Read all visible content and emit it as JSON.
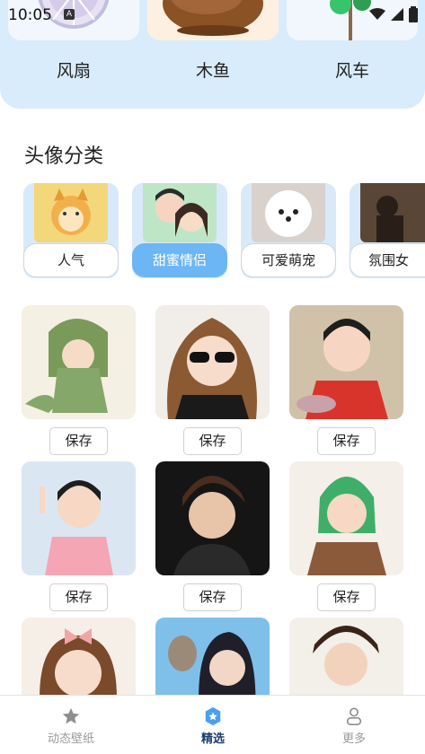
{
  "status_bar": {
    "time": "10:05",
    "badge": "A"
  },
  "tools": [
    {
      "label": "风扇"
    },
    {
      "label": "木鱼"
    },
    {
      "label": "风车"
    }
  ],
  "section_title": "头像分类",
  "categories": [
    {
      "label": "人气",
      "active": false
    },
    {
      "label": "甜蜜情侣",
      "active": true
    },
    {
      "label": "可爱萌宠",
      "active": false
    },
    {
      "label": "氛围女",
      "active": false
    }
  ],
  "grid": [
    {
      "save_label": "保存"
    },
    {
      "save_label": "保存"
    },
    {
      "save_label": "保存"
    },
    {
      "save_label": "保存"
    },
    {
      "save_label": "保存"
    },
    {
      "save_label": "保存"
    }
  ],
  "bottom_nav": [
    {
      "label": "动态壁纸",
      "icon": "star-icon",
      "active": false
    },
    {
      "label": "精选",
      "icon": "badge-star-icon",
      "active": true
    },
    {
      "label": "更多",
      "icon": "person-icon",
      "active": false
    }
  ],
  "colors": {
    "accent": "#6cb6f5",
    "panel": "#d9ecfb",
    "nav_active": "#1d3d6e"
  }
}
